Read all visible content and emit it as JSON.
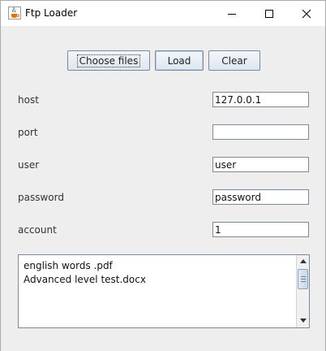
{
  "window": {
    "title": "Ftp Loader",
    "icon": "java-cup-icon"
  },
  "toolbar": {
    "choose_files_label": "Choose files",
    "load_label": "Load",
    "clear_label": "Clear"
  },
  "form": {
    "host": {
      "label": "host",
      "value": "127.0.0.1"
    },
    "port": {
      "label": "port",
      "value": ""
    },
    "user": {
      "label": "user",
      "value": "user"
    },
    "password": {
      "label": "password",
      "value": "password"
    },
    "account": {
      "label": "account",
      "value": "1"
    }
  },
  "file_list": {
    "lines": [
      "english words .pdf",
      "Advanced level test.docx"
    ]
  }
}
